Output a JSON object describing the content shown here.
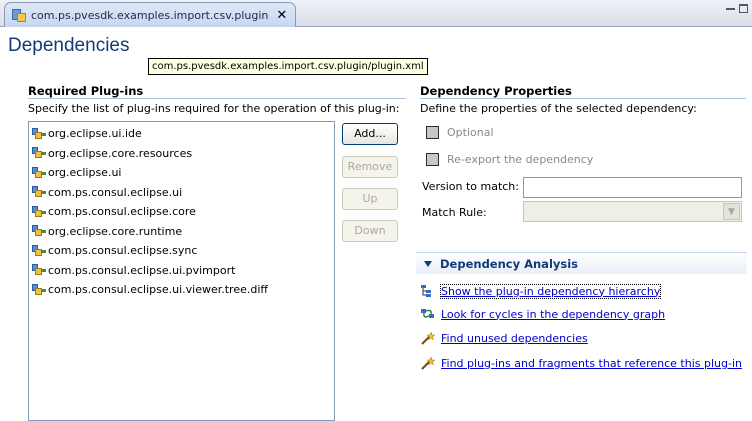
{
  "editor_tab": {
    "title": "com.ps.pvesdk.examples.import.csv.plugin",
    "close": "✕"
  },
  "page": {
    "title": "Dependencies",
    "tooltip": "com.ps.pvesdk.examples.import.csv.plugin/plugin.xml"
  },
  "required_plugins": {
    "title": "Required Plug-ins",
    "description": "Specify the list of plug-ins required for the operation of this plug-in:",
    "items": [
      "org.eclipse.ui.ide",
      "org.eclipse.core.resources",
      "org.eclipse.ui",
      "com.ps.consul.eclipse.ui",
      "com.ps.consul.eclipse.core",
      "org.eclipse.core.runtime",
      "com.ps.consul.eclipse.sync",
      "com.ps.consul.eclipse.ui.pvimport",
      "com.ps.consul.eclipse.ui.viewer.tree.diff"
    ],
    "buttons": {
      "add": "Add...",
      "remove": "Remove",
      "up": "Up",
      "down": "Down"
    }
  },
  "dependency_properties": {
    "title": "Dependency Properties",
    "description": "Define the properties of the selected dependency:",
    "optional_label": "Optional",
    "reexport_label": "Re-export the dependency",
    "version_label": "Version to match:",
    "version_value": "",
    "match_rule_label": "Match Rule:",
    "match_rule_value": ""
  },
  "dependency_analysis": {
    "title": "Dependency Analysis",
    "links": [
      "Show the plug-in dependency hierarchy",
      "Look for cycles in the dependency graph",
      "Find unused dependencies",
      "Find plug-ins and fragments that reference this plug-in"
    ]
  },
  "colors": {
    "header_text": "#123a78",
    "link": "#0000cc",
    "section_rule": "#a9c3e6"
  }
}
